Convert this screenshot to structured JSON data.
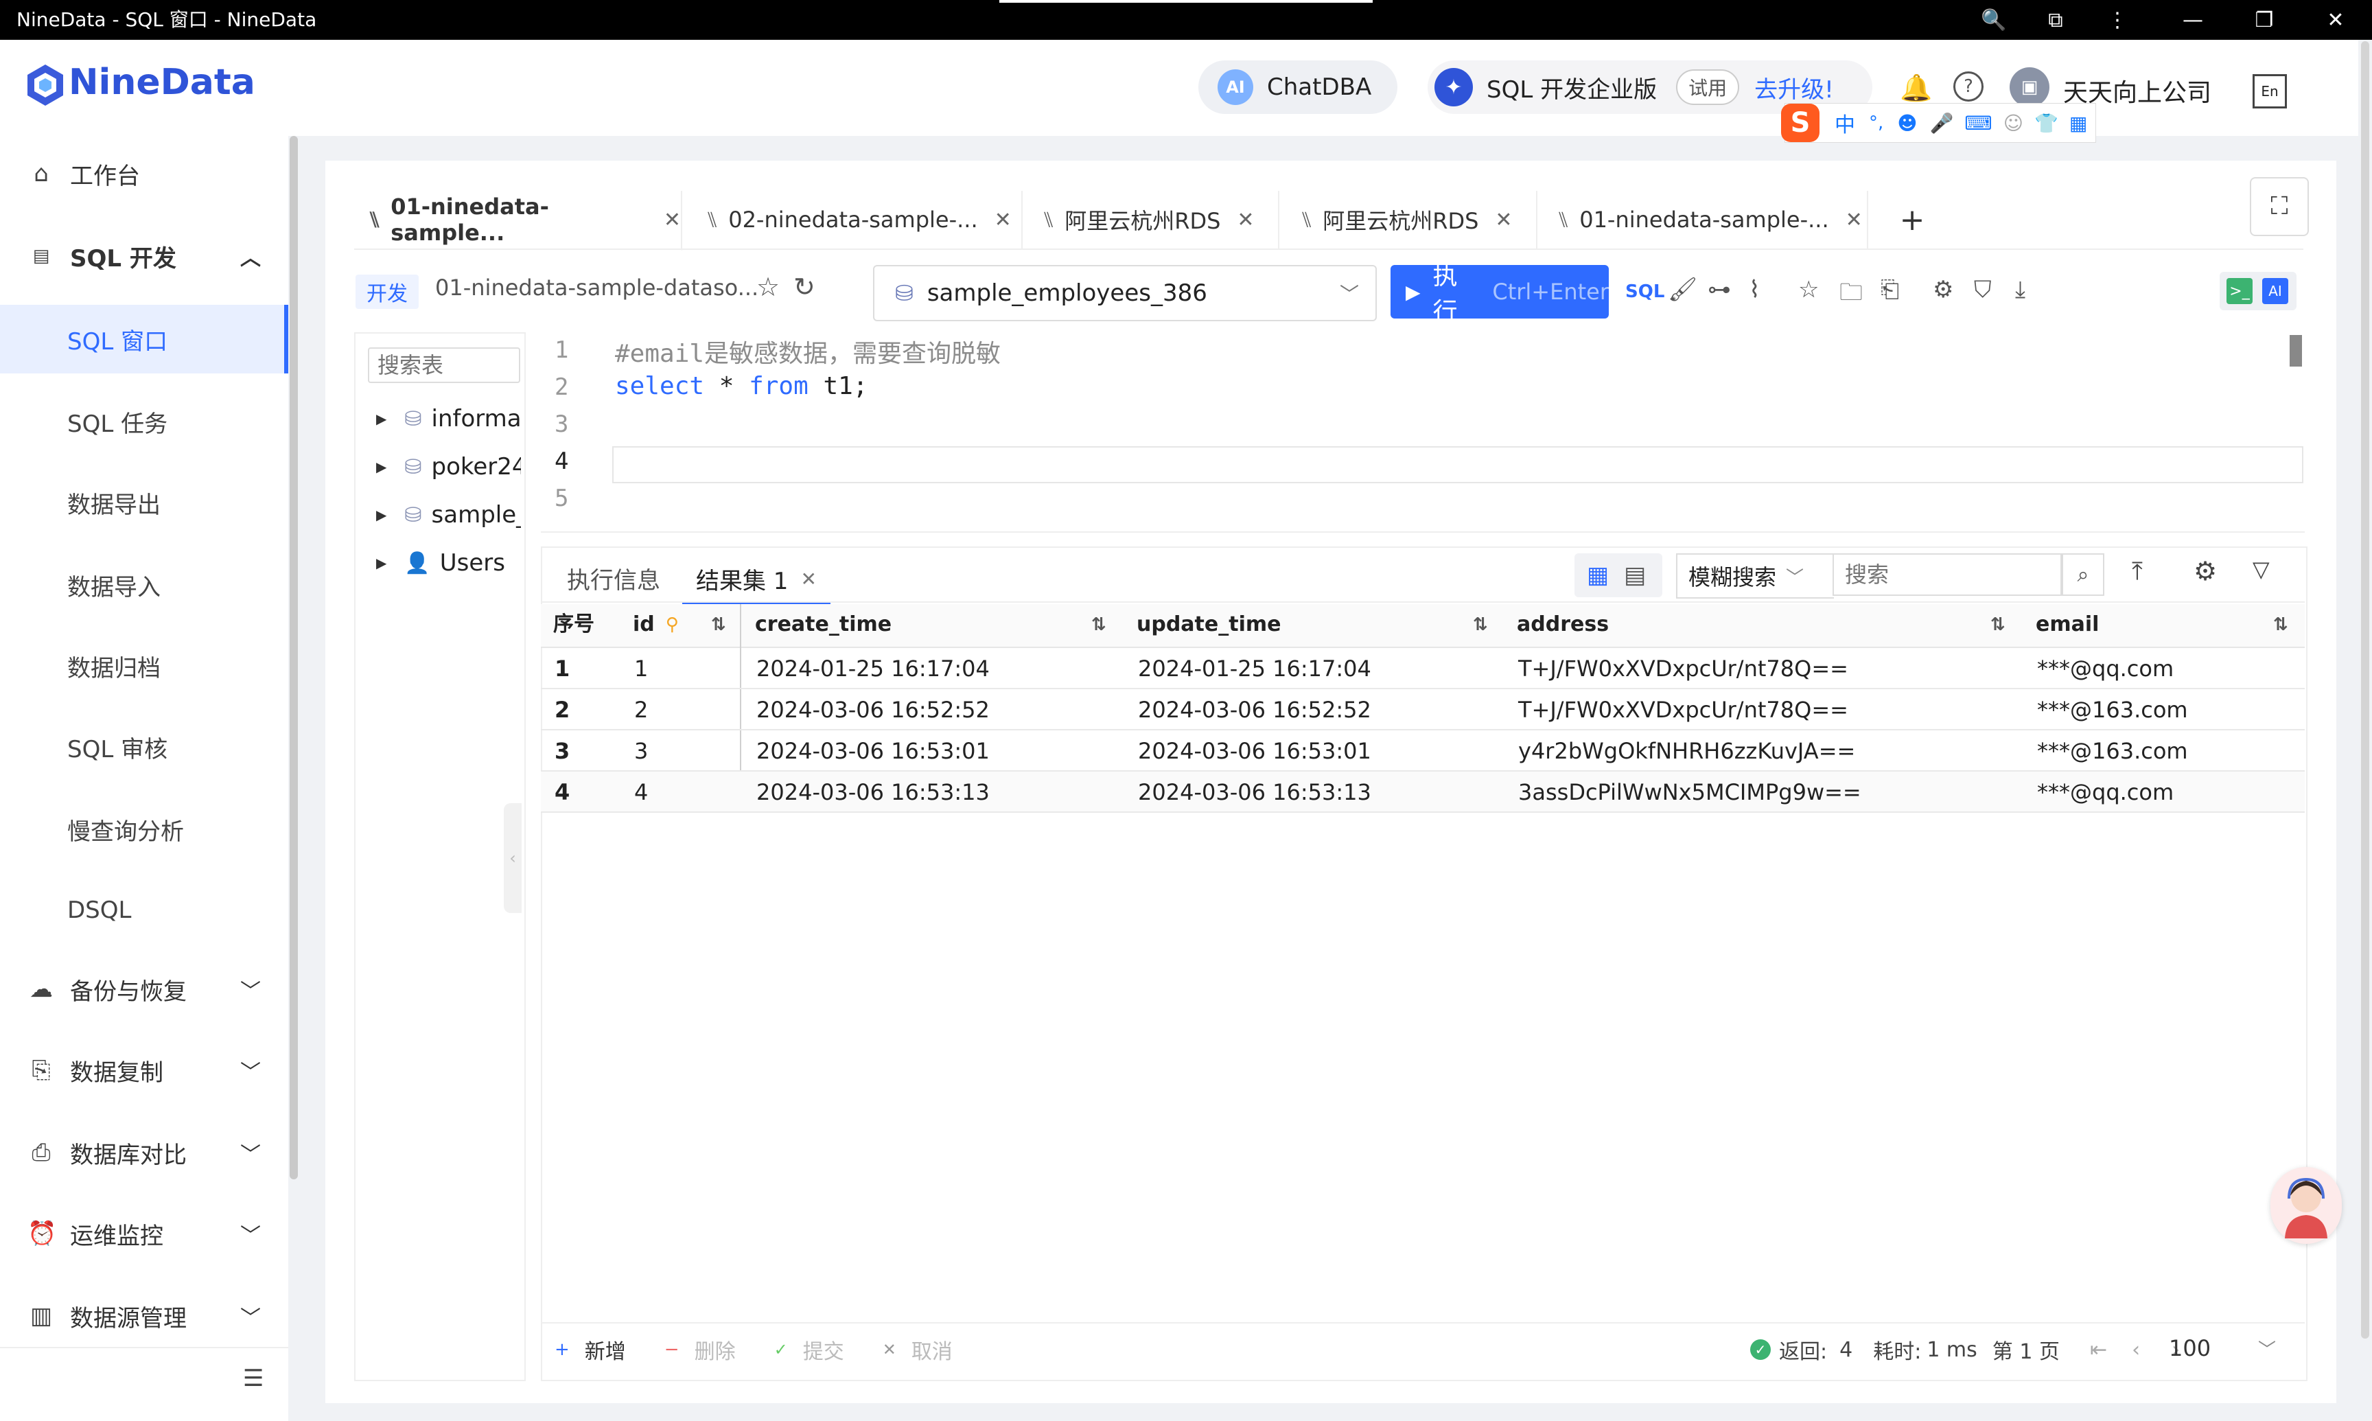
{
  "window": {
    "title": "NineData - SQL 窗口 - NineData"
  },
  "header": {
    "brand": "NineData",
    "chatdba": "ChatDBA",
    "edition": "SQL 开发企业版",
    "trial": "试用",
    "upgrade": "去升级!",
    "company": "天天向上公司"
  },
  "sidebar": {
    "workbench": "工作台",
    "sql_dev": "SQL 开发",
    "sub": [
      "SQL 窗口",
      "SQL 任务",
      "数据导出",
      "数据导入",
      "数据归档",
      "SQL 审核",
      "慢查询分析",
      "DSQL"
    ],
    "groups": [
      "备份与恢复",
      "数据复制",
      "数据库对比",
      "运维监控",
      "数据源管理"
    ]
  },
  "tabs": [
    {
      "label": "01-ninedata-sample..."
    },
    {
      "label": "02-ninedata-sample-..."
    },
    {
      "label": "阿里云杭州RDS"
    },
    {
      "label": "阿里云杭州RDS"
    },
    {
      "label": "01-ninedata-sample-..."
    }
  ],
  "toolbar": {
    "env_badge": "开发",
    "datasource": "01-ninedata-sample-dataso...",
    "database": "sample_employees_386",
    "run_label": "执行",
    "run_shortcut": "Ctrl+Enter"
  },
  "tree": {
    "search_placeholder": "搜索表",
    "items": [
      "informat",
      "poker24",
      "sample_e",
      "Users"
    ]
  },
  "editor": {
    "line_numbers": [
      "1",
      "2",
      "3",
      "4",
      "5"
    ],
    "comment": "#email是敏感数据，需要查询脱敏",
    "kw_select": "select",
    "star": " * ",
    "kw_from": "from",
    "table": " t1;"
  },
  "results": {
    "tab_info": "执行信息",
    "tab_result": "结果集 1",
    "fuzzy_search": "模糊搜索",
    "search_placeholder": "搜索",
    "columns": [
      "序号",
      "id",
      "create_time",
      "update_time",
      "address",
      "email"
    ],
    "rows": [
      [
        "1",
        "1",
        "2024-01-25 16:17:04",
        "2024-01-25 16:17:04",
        "T+J/FW0xXVDxpcUr/nt78Q==",
        "***@qq.com"
      ],
      [
        "2",
        "2",
        "2024-03-06 16:52:52",
        "2024-03-06 16:52:52",
        "T+J/FW0xXVDxpcUr/nt78Q==",
        "***@163.com"
      ],
      [
        "3",
        "3",
        "2024-03-06 16:53:01",
        "2024-03-06 16:53:01",
        "y4r2bWgOkfNHRH6zzKuvJA==",
        "***@163.com"
      ],
      [
        "4",
        "4",
        "2024-03-06 16:53:13",
        "2024-03-06 16:53:13",
        "3assDcPilWwNx5MCIMPg9w==",
        "***@qq.com"
      ]
    ],
    "footer": {
      "add": "新增",
      "delete": "删除",
      "submit": "提交",
      "cancel": "取消",
      "returned_label": "返回:",
      "returned": "4",
      "elapsed_label": "耗时:",
      "elapsed": "1 ms",
      "page": "第 1 页",
      "page_size": "100"
    }
  },
  "colors": {
    "accent": "#2f6bff",
    "brand": "#2f54d8",
    "keyword": "#2f6bff",
    "comment": "#8c8c8c"
  }
}
